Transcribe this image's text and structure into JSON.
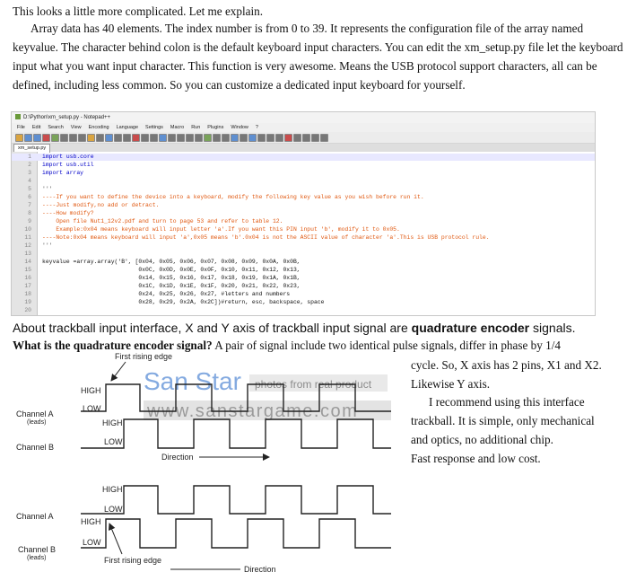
{
  "intro": {
    "heading": "This looks a little more complicated. Let me explain.",
    "body": "Array data has 40 elements. The index number is from 0 to 39. It represents the configuration file of the array named keyvalue. The character behind colon is the default keyboard input characters. You can edit the xm_setup.py file let the keyboard input what you want input character. This function is very awesome. Means the USB protocol support characters, all can be defined, including less common. So you can customize a dedicated input keyboard for yourself."
  },
  "editor": {
    "title": "D:\\Python\\xm_setup.py - Notepad++",
    "menu": [
      "File",
      "Edit",
      "Search",
      "View",
      "Encoding",
      "Language",
      "Settings",
      "Macro",
      "Run",
      "Plugins",
      "Window",
      "?"
    ],
    "tab": "xm_setup.py",
    "lines": [
      {
        "n": "1",
        "text": "import usb.core",
        "style": "kw"
      },
      {
        "n": "2",
        "text": "import usb.util",
        "style": "kw"
      },
      {
        "n": "3",
        "text": "import array",
        "style": "kw"
      },
      {
        "n": "4",
        "text": "",
        "style": ""
      },
      {
        "n": "5",
        "text": "'''",
        "style": "str"
      },
      {
        "n": "6",
        "text": "----If you want to define the device into a keyboard, modify the following key value as you wish before run it.",
        "style": "cm"
      },
      {
        "n": "7",
        "text": "----Just modify,no add or detract.",
        "style": "cm"
      },
      {
        "n": "8",
        "text": "----How modify?",
        "style": "cm"
      },
      {
        "n": "9",
        "text": "    Open file Nut1_12v2.pdf and turn to page 53 and refer to table 12.",
        "style": "cm"
      },
      {
        "n": "10",
        "text": "    Example:0x04 means keyboard will input letter 'a'.If you want this PIN input 'b', modify it to 0x05.",
        "style": "cm"
      },
      {
        "n": "11",
        "text": "----Note:0x04 means keyboard will input 'a',0x05 means 'b'.0x04 is not the ASCII value of character 'a'.This is USB protocol rule.",
        "style": "cm"
      },
      {
        "n": "12",
        "text": "'''",
        "style": "str"
      },
      {
        "n": "13",
        "text": "",
        "style": ""
      },
      {
        "n": "14",
        "text": "keyvalue =array.array('B', [0x04, 0x05, 0x06, 0x07, 0x08, 0x09, 0x0A, 0x0B,",
        "style": ""
      },
      {
        "n": "15",
        "text": "                            0x0C, 0x0D, 0x0E, 0x0F, 0x10, 0x11, 0x12, 0x13,",
        "style": ""
      },
      {
        "n": "16",
        "text": "                            0x14, 0x15, 0x16, 0x17, 0x18, 0x19, 0x1A, 0x1B,",
        "style": ""
      },
      {
        "n": "17",
        "text": "                            0x1C, 0x1D, 0x1E, 0x1F, 0x20, 0x21, 0x22, 0x23,",
        "style": ""
      },
      {
        "n": "18",
        "text": "                            0x24, 0x25, 0x26, 0x27, #letters and numbers",
        "style": ""
      },
      {
        "n": "19",
        "text": "                            0x28, 0x29, 0x2A, 0x2C])#return, esc, backspace, space",
        "style": ""
      },
      {
        "n": "20",
        "text": "",
        "style": ""
      }
    ]
  },
  "trackball": {
    "pre": "About trackball input interface, X and Y axis of trackball input signal are ",
    "emph": "quadrature encoder",
    "post": " signals.",
    "question": "What is the quadrature encoder signal?",
    "answer_start": " A pair of signal include two identical pulse signals, differ in phase by 1/4",
    "side_lines": [
      "cycle. So, X axis has 2 pins, X1 and X2.",
      "Likewise Y axis."
    ],
    "recommend": [
      "I recommend using this interface",
      "trackball. It is simple, only mechanical",
      "and optics, no additional chip.",
      "Fast response and low cost."
    ]
  },
  "diagram_top": {
    "first_edge": "First rising edge",
    "high": "HIGH",
    "low": "LOW",
    "channel_a": "Channel A",
    "channel_a_sub": "(leads)",
    "channel_b": "Channel B",
    "direction": "Direction"
  },
  "diagram_bottom": {
    "high": "HIGH",
    "low": "LOW",
    "channel_a": "Channel A",
    "channel_b": "Channel B",
    "channel_b_sub": "(leads)",
    "first_edge": "First rising edge",
    "direction": "Direction"
  },
  "watermark": {
    "brand": "San Star",
    "caption": "photos from real product",
    "url": "www.sanstargame.com"
  },
  "colors": {
    "keyword": "#0000c8",
    "comment": "#e05810",
    "watermark_blue": "#5b8ed6"
  }
}
